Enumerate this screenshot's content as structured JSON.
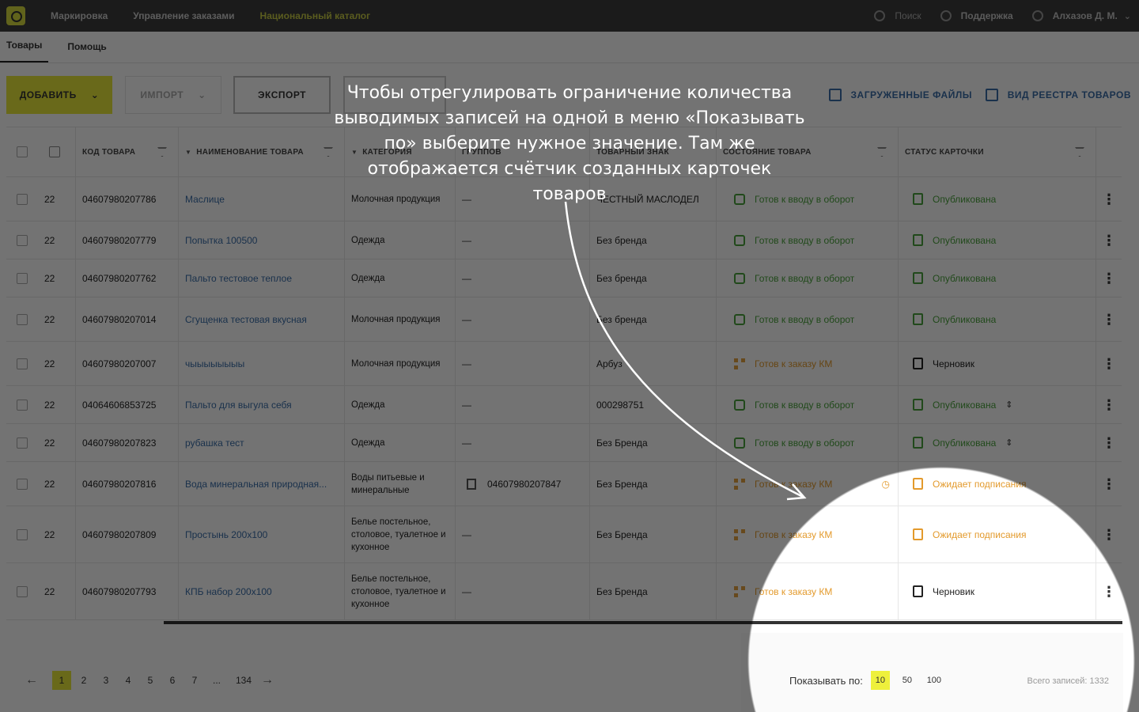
{
  "nav": {
    "items": [
      "Маркировка",
      "Управление заказами",
      "Национальный каталог"
    ],
    "search": "Поиск",
    "support": "Поддержка",
    "user": "Алхазов Д. М."
  },
  "subtabs": [
    "Товары",
    "Помощь"
  ],
  "toolbar": {
    "add": "ДОБАВИТЬ",
    "import": "ИМПОРТ",
    "export": "ЭКСПОРТ",
    "files": "ЗАГРУЖЕННЫЕ ФАЙЛЫ",
    "view": "ВИД РЕЕСТРА ТОВАРОВ"
  },
  "columns": {
    "code": "КОД ТОВАРА",
    "name": "НАИМЕНОВАНИЕ ТОВАРА",
    "category": "КАТЕГОРИЯ",
    "group": "ГРУППОВ",
    "brand": "ТОВАРНЫЙ ЗНАК",
    "state": "СОСТОЯНИЕ ТОВАРА",
    "status": "СТАТУС КАРТОЧКИ"
  },
  "rows": [
    {
      "date": "22",
      "code": "04607980207786",
      "name": "Маслице",
      "category": "Молочная продукция",
      "group": "—",
      "brand": "ЧЕСТНЫЙ МАСЛОДЕЛ",
      "state": "Готов к вводу в оборот",
      "status": "Опубликована"
    },
    {
      "date": "22",
      "code": "04607980207779",
      "name": "Попытка 100500",
      "category": "Одежда",
      "group": "—",
      "brand": "Без бренда",
      "state": "Готов к вводу в оборот",
      "status": "Опубликована"
    },
    {
      "date": "22",
      "code": "04607980207762",
      "name": "Пальто тестовое теплое",
      "category": "Одежда",
      "group": "—",
      "brand": "Без бренда",
      "state": "Готов к вводу в оборот",
      "status": "Опубликована"
    },
    {
      "date": "22",
      "code": "04607980207014",
      "name": "Сгущенка тестовая вкусная",
      "category": "Молочная продукция",
      "group": "—",
      "brand": "Без бренда",
      "state": "Готов к вводу в оборот",
      "status": "Опубликована"
    },
    {
      "date": "22",
      "code": "04607980207007",
      "name": "чыыыыыыыы",
      "category": "Молочная продукция",
      "group": "—",
      "brand": "Арбуз",
      "state": "Готов к заказу КМ",
      "status": "Черновик"
    },
    {
      "date": "22",
      "code": "04064606853725",
      "name": "Пальто для выгула себя",
      "category": "Одежда",
      "group": "—",
      "brand": "000298751",
      "state": "Готов к вводу в оборот",
      "status": "Опубликована"
    },
    {
      "date": "22",
      "code": "04607980207823",
      "name": "рубашка тест",
      "category": "Одежда",
      "group": "—",
      "brand": "Без Бренда",
      "state": "Готов к вводу в оборот",
      "status": "Опубликована"
    },
    {
      "date": "22",
      "code": "04607980207816",
      "name": "Вода минеральная природная...",
      "category": "Воды питьевые и минеральные",
      "group": "04607980207847",
      "brand": "Без Бренда",
      "state": "Готов к заказу КМ",
      "status": "Ожидает подписания"
    },
    {
      "date": "22",
      "code": "04607980207809",
      "name": "Простынь 200х100",
      "category": "Белье постельное, столовое, туалетное и кухонное",
      "group": "—",
      "brand": "Без Бренда",
      "state": "Готов к заказу КМ",
      "status": "Ожидает подписания"
    },
    {
      "date": "22",
      "code": "04607980207793",
      "name": "КПБ набор 200х100",
      "category": "Белье постельное, столовое, туалетное и кухонное",
      "group": "—",
      "brand": "Без Бренда",
      "state": "Готов к заказу КМ",
      "status": "Черновик"
    }
  ],
  "pager": {
    "pages": [
      "1",
      "2",
      "3",
      "4",
      "5",
      "6",
      "7",
      "...",
      "134"
    ],
    "active": "1",
    "per_page_label": "Показывать по:",
    "per_page_options": [
      "10",
      "50",
      "100"
    ],
    "per_page_active": "10",
    "total": "Всего записей: 1332"
  },
  "tip": "Чтобы отрегулировать ограничение количества выводимых записей на одной в меню «Показывать по» выберите нужное значение. Там же отображается счётчик созданных карточек товаров",
  "colors": {
    "accent": "#e8e93a",
    "link": "#3a6ea8",
    "ok": "#4aa33c",
    "warn": "#e39a2c",
    "topbar": "#3c3c3c"
  }
}
